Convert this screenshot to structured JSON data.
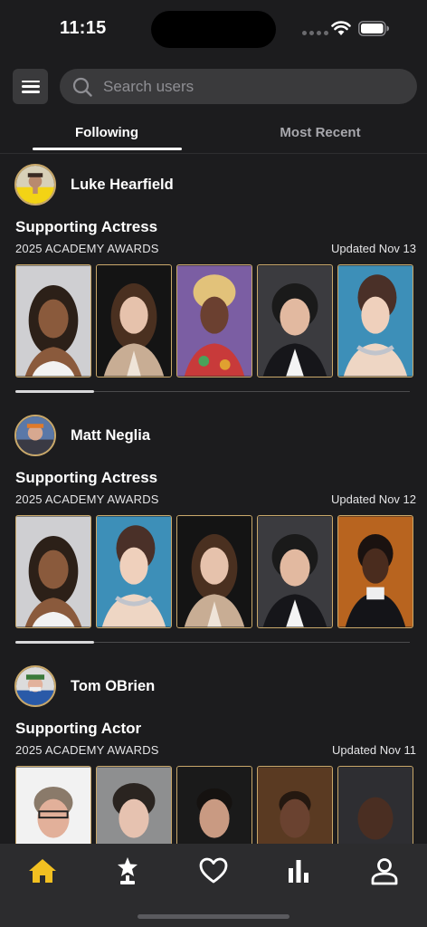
{
  "status_bar": {
    "time": "11:15"
  },
  "header": {
    "search": {
      "placeholder": "Search users",
      "value": ""
    },
    "tabs": [
      {
        "label": "Following",
        "active": true
      },
      {
        "label": "Most Recent",
        "active": false
      }
    ]
  },
  "colors": {
    "accent_gold": "#f2c021",
    "frame_gold": "#c9a86a",
    "background": "#1c1c1e",
    "tab_bar": "#2c2c2e"
  },
  "feed": [
    {
      "user": "Luke Hearfield",
      "category": "Supporting Actress",
      "event": "2025 ACADEMY AWARDS",
      "updated": "Updated Nov 13",
      "progress": 0.2,
      "photos": [
        "nominee-portrait",
        "nominee-portrait",
        "nominee-portrait",
        "nominee-portrait",
        "nominee-portrait"
      ]
    },
    {
      "user": "Matt Neglia",
      "category": "Supporting Actress",
      "event": "2025 ACADEMY AWARDS",
      "updated": "Updated Nov 12",
      "progress": 0.2,
      "photos": [
        "nominee-portrait",
        "nominee-portrait",
        "nominee-portrait",
        "nominee-portrait",
        "nominee-portrait"
      ]
    },
    {
      "user": "Tom OBrien",
      "category": "Supporting Actor",
      "event": "2025 ACADEMY AWARDS",
      "updated": "Updated Nov 11",
      "progress": 0.2,
      "photos": [
        "nominee-portrait",
        "nominee-portrait",
        "nominee-portrait",
        "nominee-portrait",
        "nominee-portrait"
      ]
    }
  ],
  "tab_bar": {
    "items": [
      {
        "icon": "home-icon",
        "active": true
      },
      {
        "icon": "award-icon",
        "active": false
      },
      {
        "icon": "heart-icon",
        "active": false
      },
      {
        "icon": "chart-icon",
        "active": false
      },
      {
        "icon": "profile-icon",
        "active": false
      }
    ]
  }
}
